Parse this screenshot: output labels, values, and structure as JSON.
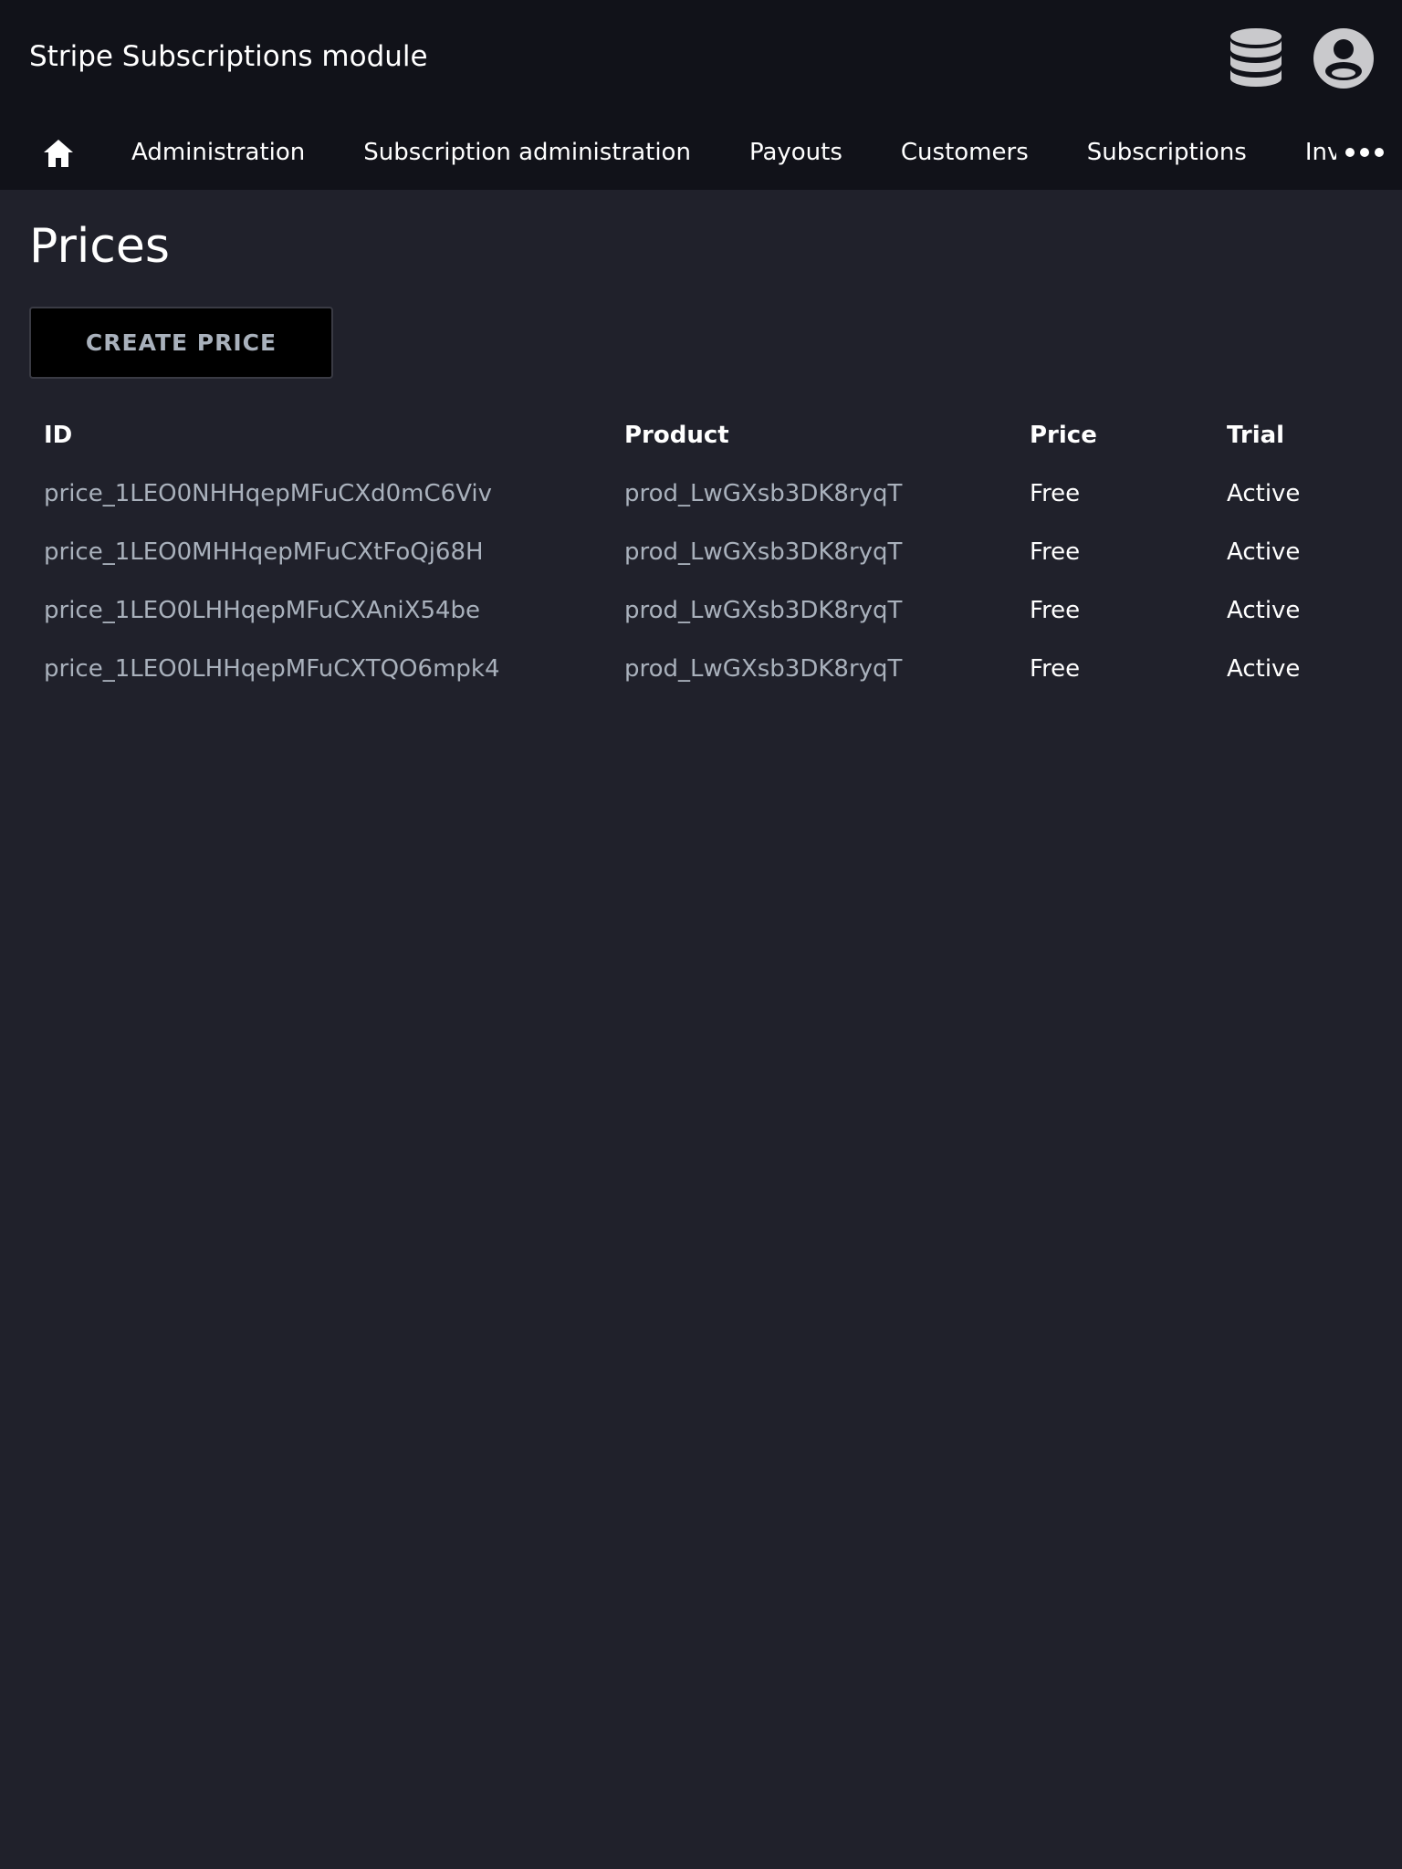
{
  "header": {
    "app_title": "Stripe Subscriptions module",
    "database_icon": "database-icon",
    "account_icon": "account-circle-icon"
  },
  "nav": {
    "home_icon": "home-icon",
    "tabs": [
      {
        "label": "Administration"
      },
      {
        "label": "Subscription administration"
      },
      {
        "label": "Payouts"
      },
      {
        "label": "Customers"
      },
      {
        "label": "Subscriptions"
      },
      {
        "label": "Invoices"
      }
    ],
    "more_icon": "more-horizontal-icon"
  },
  "main": {
    "title": "Prices",
    "create_button_label": "CREATE PRICE",
    "table": {
      "columns": [
        "ID",
        "Product",
        "Price",
        "Trial"
      ],
      "rows": [
        {
          "id": "price_1LEO0NHHqepMFuCXd0mC6Viv",
          "product": "prod_LwGXsb3DK8ryqT",
          "price": "Free",
          "trial": "Active"
        },
        {
          "id": "price_1LEO0MHHqepMFuCXtFoQj68H",
          "product": "prod_LwGXsb3DK8ryqT",
          "price": "Free",
          "trial": "Active"
        },
        {
          "id": "price_1LEO0LHHqepMFuCXAniX54be",
          "product": "prod_LwGXsb3DK8ryqT",
          "price": "Free",
          "trial": "Active"
        },
        {
          "id": "price_1LEO0LHHqepMFuCXTQO6mpk4",
          "product": "prod_LwGXsb3DK8ryqT",
          "price": "Free",
          "trial": "Active"
        }
      ]
    }
  },
  "colors": {
    "background": "#20212b",
    "topbar": "#111219",
    "muted_text": "#a9b1bc",
    "icon": "#c9c9cc"
  }
}
